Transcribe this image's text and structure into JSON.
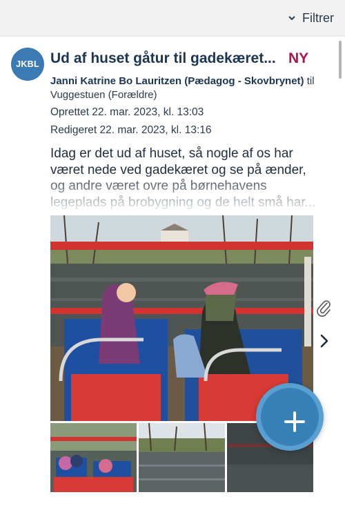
{
  "toolbar": {
    "filter_label": "Filtrer",
    "filter_icon": "chevron-down-icon"
  },
  "post": {
    "avatar_initials": "JKBL",
    "title": "Ud af huset gåtur til gadekæret...",
    "badge": "NY",
    "author": "Janni Katrine Bo Lauritzen (Pædagog - Skovbrynet)",
    "to_word": "til",
    "recipient": "Vuggestuen (Forældre)",
    "created": "Oprettet 22. mar. 2023, kl. 13:03",
    "edited": "Redigeret 22. mar. 2023, kl. 13:16",
    "body": "Idag er det ud af huset, så nogle af os har været nede ved gadekæret og se på ænder, og andre været ovre på børnehavens legeplads på brobygning og de helt små har...",
    "attachment_icon": "paperclip-icon",
    "next_icon": "chevron-right-icon"
  },
  "fab": {
    "icon": "plus-icon"
  },
  "colors": {
    "accent": "#3c7ab3",
    "title": "#1c3553",
    "badge": "#b0134f",
    "fab": "#3780b8"
  }
}
